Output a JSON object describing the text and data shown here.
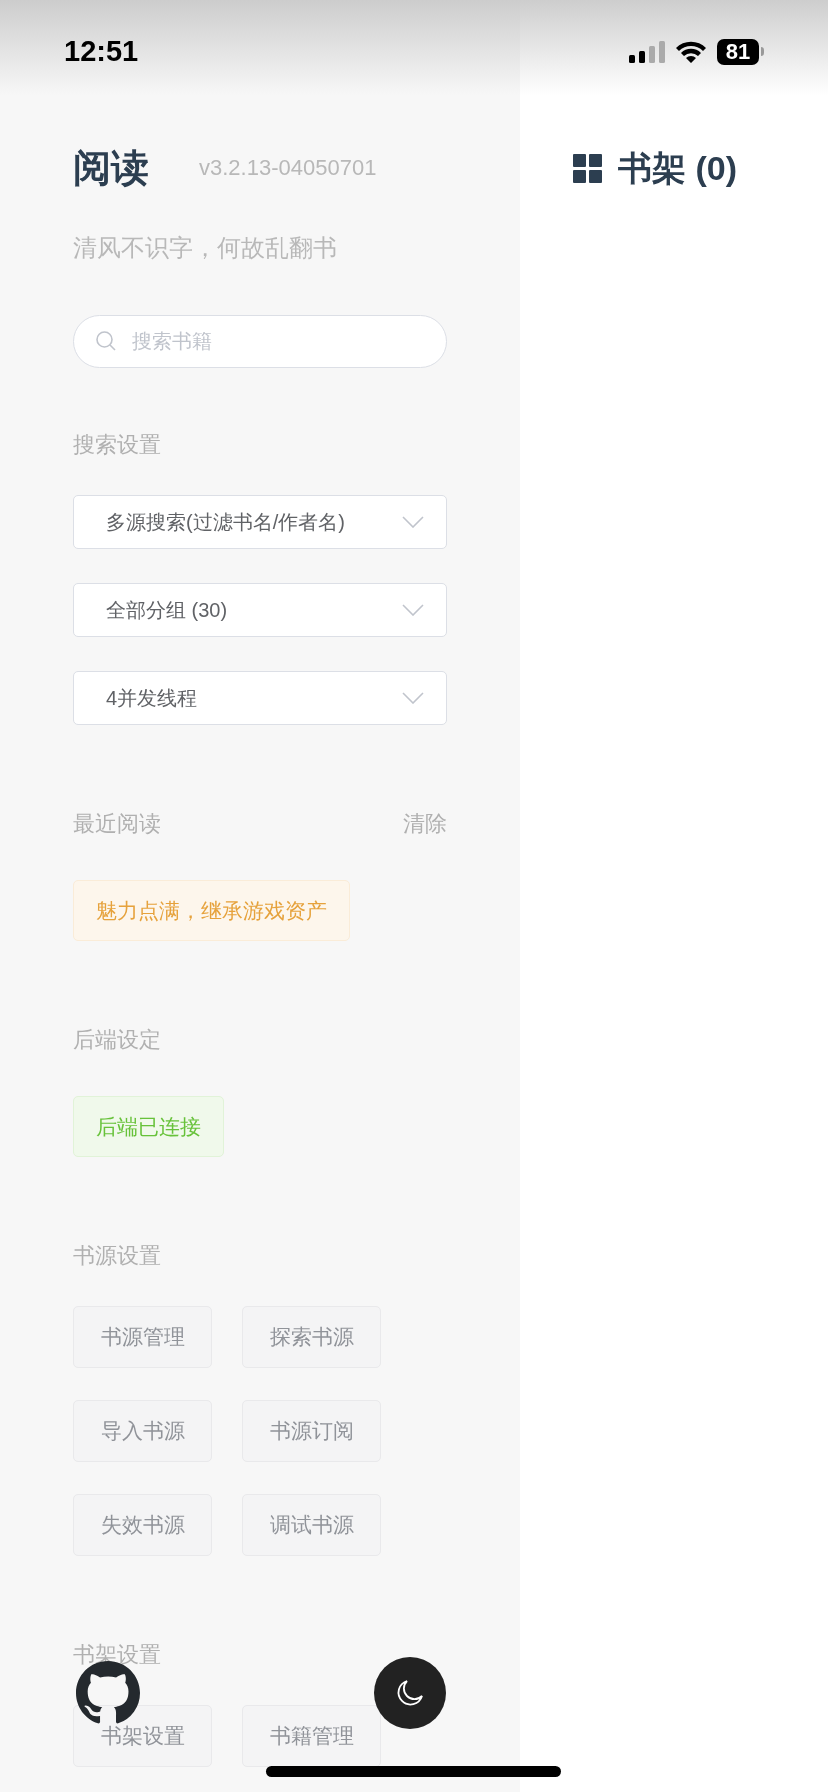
{
  "status_bar": {
    "time": "12:51",
    "battery": "81"
  },
  "sidebar": {
    "title": "阅读",
    "version": "v3.2.13-04050701",
    "slogan": "清风不识字，何故乱翻书",
    "search": {
      "placeholder": "搜索书籍"
    },
    "sections": [
      {
        "kind": "selects",
        "heading": "搜索设置",
        "selects": [
          "多源搜索(过滤书名/作者名)",
          "全部分组 (30)",
          "4并发线程"
        ]
      },
      {
        "kind": "tags",
        "heading": "最近阅读",
        "action": "清除",
        "tags": [
          {
            "label": "魅力点满，继承游戏资产",
            "kind": "warning"
          }
        ]
      },
      {
        "kind": "tags",
        "heading": "后端设定",
        "tags": [
          {
            "label": "后端已连接",
            "kind": "success"
          }
        ]
      },
      {
        "kind": "buttons",
        "heading": "书源设置",
        "buttons": [
          "书源管理",
          "探索书源",
          "导入书源",
          "书源订阅",
          "失效书源",
          "调试书源"
        ]
      },
      {
        "kind": "buttons",
        "heading": "书架设置",
        "buttons": [
          "书架设置",
          "书籍管理"
        ]
      }
    ]
  },
  "main": {
    "title": "书架 (0)"
  }
}
